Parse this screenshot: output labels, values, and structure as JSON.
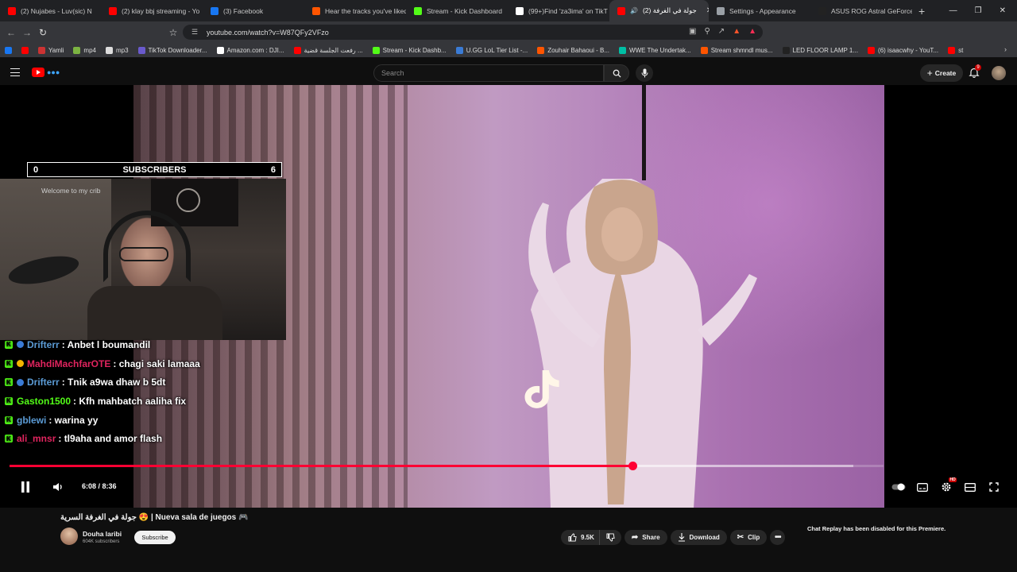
{
  "tabs": [
    {
      "label": "(2) Nujabes - Luv(sic) N",
      "color": "#ff0000"
    },
    {
      "label": "(2) klay bbj streaming - Yo",
      "color": "#ff0000"
    },
    {
      "label": "(3) Facebook",
      "color": "#1877f2"
    },
    {
      "label": "Hear the tracks you've liked",
      "color": "#ff5500"
    },
    {
      "label": "Stream - Kick Dashboard",
      "color": "#53fc18"
    },
    {
      "label": "(99+)Find 'za3ima' on TikT",
      "color": "#ffffff"
    },
    {
      "label": "(2) جولة في الغرفة",
      "color": "#ff0000",
      "active": true
    },
    {
      "label": "Settings - Appearance",
      "color": "#9aa0a6"
    },
    {
      "label": "ASUS ROG Astral GeForce",
      "color": "#222222"
    }
  ],
  "address": {
    "url": "youtube.com/watch?v=W87QFy2VFzo"
  },
  "bookmarks": [
    {
      "label": "",
      "color": "#1877f2"
    },
    {
      "label": "",
      "color": "#ff0000"
    },
    {
      "label": "Yamli",
      "color": "#cc3333"
    },
    {
      "label": "mp4",
      "color": "#7cb342"
    },
    {
      "label": "mp3",
      "color": "#dddddd"
    },
    {
      "label": "TikTok Downloader...",
      "color": "#6a5acd"
    },
    {
      "label": "Amazon.com : DJI...",
      "color": "#ffffff"
    },
    {
      "label": "رفعت الجلسة قضية ...",
      "color": "#ff0000"
    },
    {
      "label": "Stream - Kick Dashb...",
      "color": "#53fc18"
    },
    {
      "label": "U.GG LoL Tier List -...",
      "color": "#3a7bd5"
    },
    {
      "label": "Zouhair Bahaoui - B...",
      "color": "#ff5500"
    },
    {
      "label": "WWE The Undertak...",
      "color": "#00bfa5"
    },
    {
      "label": "Stream shmndl mus...",
      "color": "#ff5500"
    },
    {
      "label": "LED FLOOR LAMP 1...",
      "color": "#222222"
    },
    {
      "label": "(6) isaacwhy - YouT...",
      "color": "#ff0000"
    },
    {
      "label": "st",
      "color": "#ff0000"
    }
  ],
  "youtube": {
    "search_placeholder": "Search",
    "create_label": "Create",
    "notification_count": "9"
  },
  "overlay": {
    "sub_left": "0",
    "sub_label": "SUBSCRIBERS",
    "sub_right": "6",
    "welcome_text": "Welcome to my crib"
  },
  "chat": [
    {
      "user": "Drifterr",
      "msg": ": Anbet l boumandil",
      "color": "#5b9bd5",
      "badge": "#3a7bd5"
    },
    {
      "user": "MahdiMachfarOTE",
      "msg": ": chagi saki lamaaa",
      "color": "#e0245e",
      "badge": "#f4b400"
    },
    {
      "user": "Drifterr",
      "msg": ": Tnik a9wa dhaw b 5dt",
      "color": "#5b9bd5",
      "badge": "#3a7bd5"
    },
    {
      "user": "Gaston1500",
      "msg": ": Kfh mahbatch aaliha fix",
      "color": "#53fc18",
      "badge": ""
    },
    {
      "user": "gblewi",
      "msg": ": warina yy",
      "color": "#5b9bd5",
      "badge": ""
    },
    {
      "user": "ali_mnsr",
      "msg": ": tl9aha and amor flash",
      "color": "#e0245e",
      "badge": ""
    }
  ],
  "player": {
    "time_current": "6:08",
    "time_total": "8:36",
    "timecode": "6:08 / 8:36",
    "progress_fraction": 0.713,
    "buffered_fraction": 0.965,
    "quality_badge": "HD"
  },
  "video_info": {
    "title": "جولة في الغرفة السرية 😍 | Nueva sala de juegos 🎮",
    "channel": "Douha laribi",
    "subscribers": "604K subscribers",
    "subscribe_label": "Subscribe",
    "likes": "9.5K",
    "share_label": "Share",
    "download_label": "Download",
    "clip_label": "Clip",
    "chat_replay_notice": "Chat Replay has been disabled for this Premiere."
  },
  "colors": {
    "accent_red": "#ff0033",
    "kick_green": "#53fc18",
    "yt_bg": "#0f0f0f"
  }
}
